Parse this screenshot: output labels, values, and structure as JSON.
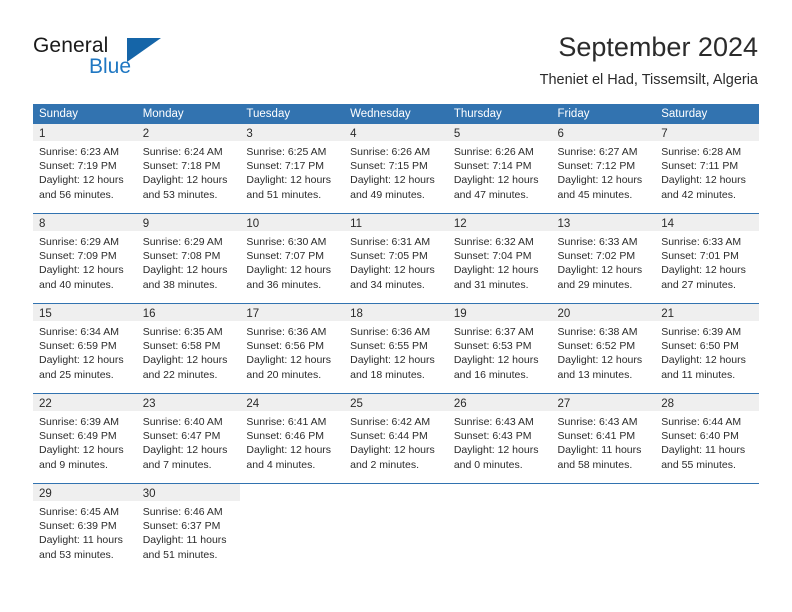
{
  "brand": {
    "name_top": "General",
    "name_bottom": "Blue",
    "accent_color": "#1f77c2",
    "triangle_color": "#1565a8"
  },
  "header": {
    "title": "September 2024",
    "subtitle": "Theniet el Had, Tissemsilt, Algeria"
  },
  "theme": {
    "header_blue": "#3273b0",
    "daynum_band": "#efefef",
    "text": "#2b2b2b"
  },
  "weekday_headers": [
    "Sunday",
    "Monday",
    "Tuesday",
    "Wednesday",
    "Thursday",
    "Friday",
    "Saturday"
  ],
  "weeks": [
    [
      {
        "day": "1",
        "sunrise": "Sunrise: 6:23 AM",
        "sunset": "Sunset: 7:19 PM",
        "daylight_1": "Daylight: 12 hours",
        "daylight_2": "and 56 minutes."
      },
      {
        "day": "2",
        "sunrise": "Sunrise: 6:24 AM",
        "sunset": "Sunset: 7:18 PM",
        "daylight_1": "Daylight: 12 hours",
        "daylight_2": "and 53 minutes."
      },
      {
        "day": "3",
        "sunrise": "Sunrise: 6:25 AM",
        "sunset": "Sunset: 7:17 PM",
        "daylight_1": "Daylight: 12 hours",
        "daylight_2": "and 51 minutes."
      },
      {
        "day": "4",
        "sunrise": "Sunrise: 6:26 AM",
        "sunset": "Sunset: 7:15 PM",
        "daylight_1": "Daylight: 12 hours",
        "daylight_2": "and 49 minutes."
      },
      {
        "day": "5",
        "sunrise": "Sunrise: 6:26 AM",
        "sunset": "Sunset: 7:14 PM",
        "daylight_1": "Daylight: 12 hours",
        "daylight_2": "and 47 minutes."
      },
      {
        "day": "6",
        "sunrise": "Sunrise: 6:27 AM",
        "sunset": "Sunset: 7:12 PM",
        "daylight_1": "Daylight: 12 hours",
        "daylight_2": "and 45 minutes."
      },
      {
        "day": "7",
        "sunrise": "Sunrise: 6:28 AM",
        "sunset": "Sunset: 7:11 PM",
        "daylight_1": "Daylight: 12 hours",
        "daylight_2": "and 42 minutes."
      }
    ],
    [
      {
        "day": "8",
        "sunrise": "Sunrise: 6:29 AM",
        "sunset": "Sunset: 7:09 PM",
        "daylight_1": "Daylight: 12 hours",
        "daylight_2": "and 40 minutes."
      },
      {
        "day": "9",
        "sunrise": "Sunrise: 6:29 AM",
        "sunset": "Sunset: 7:08 PM",
        "daylight_1": "Daylight: 12 hours",
        "daylight_2": "and 38 minutes."
      },
      {
        "day": "10",
        "sunrise": "Sunrise: 6:30 AM",
        "sunset": "Sunset: 7:07 PM",
        "daylight_1": "Daylight: 12 hours",
        "daylight_2": "and 36 minutes."
      },
      {
        "day": "11",
        "sunrise": "Sunrise: 6:31 AM",
        "sunset": "Sunset: 7:05 PM",
        "daylight_1": "Daylight: 12 hours",
        "daylight_2": "and 34 minutes."
      },
      {
        "day": "12",
        "sunrise": "Sunrise: 6:32 AM",
        "sunset": "Sunset: 7:04 PM",
        "daylight_1": "Daylight: 12 hours",
        "daylight_2": "and 31 minutes."
      },
      {
        "day": "13",
        "sunrise": "Sunrise: 6:33 AM",
        "sunset": "Sunset: 7:02 PM",
        "daylight_1": "Daylight: 12 hours",
        "daylight_2": "and 29 minutes."
      },
      {
        "day": "14",
        "sunrise": "Sunrise: 6:33 AM",
        "sunset": "Sunset: 7:01 PM",
        "daylight_1": "Daylight: 12 hours",
        "daylight_2": "and 27 minutes."
      }
    ],
    [
      {
        "day": "15",
        "sunrise": "Sunrise: 6:34 AM",
        "sunset": "Sunset: 6:59 PM",
        "daylight_1": "Daylight: 12 hours",
        "daylight_2": "and 25 minutes."
      },
      {
        "day": "16",
        "sunrise": "Sunrise: 6:35 AM",
        "sunset": "Sunset: 6:58 PM",
        "daylight_1": "Daylight: 12 hours",
        "daylight_2": "and 22 minutes."
      },
      {
        "day": "17",
        "sunrise": "Sunrise: 6:36 AM",
        "sunset": "Sunset: 6:56 PM",
        "daylight_1": "Daylight: 12 hours",
        "daylight_2": "and 20 minutes."
      },
      {
        "day": "18",
        "sunrise": "Sunrise: 6:36 AM",
        "sunset": "Sunset: 6:55 PM",
        "daylight_1": "Daylight: 12 hours",
        "daylight_2": "and 18 minutes."
      },
      {
        "day": "19",
        "sunrise": "Sunrise: 6:37 AM",
        "sunset": "Sunset: 6:53 PM",
        "daylight_1": "Daylight: 12 hours",
        "daylight_2": "and 16 minutes."
      },
      {
        "day": "20",
        "sunrise": "Sunrise: 6:38 AM",
        "sunset": "Sunset: 6:52 PM",
        "daylight_1": "Daylight: 12 hours",
        "daylight_2": "and 13 minutes."
      },
      {
        "day": "21",
        "sunrise": "Sunrise: 6:39 AM",
        "sunset": "Sunset: 6:50 PM",
        "daylight_1": "Daylight: 12 hours",
        "daylight_2": "and 11 minutes."
      }
    ],
    [
      {
        "day": "22",
        "sunrise": "Sunrise: 6:39 AM",
        "sunset": "Sunset: 6:49 PM",
        "daylight_1": "Daylight: 12 hours",
        "daylight_2": "and 9 minutes."
      },
      {
        "day": "23",
        "sunrise": "Sunrise: 6:40 AM",
        "sunset": "Sunset: 6:47 PM",
        "daylight_1": "Daylight: 12 hours",
        "daylight_2": "and 7 minutes."
      },
      {
        "day": "24",
        "sunrise": "Sunrise: 6:41 AM",
        "sunset": "Sunset: 6:46 PM",
        "daylight_1": "Daylight: 12 hours",
        "daylight_2": "and 4 minutes."
      },
      {
        "day": "25",
        "sunrise": "Sunrise: 6:42 AM",
        "sunset": "Sunset: 6:44 PM",
        "daylight_1": "Daylight: 12 hours",
        "daylight_2": "and 2 minutes."
      },
      {
        "day": "26",
        "sunrise": "Sunrise: 6:43 AM",
        "sunset": "Sunset: 6:43 PM",
        "daylight_1": "Daylight: 12 hours",
        "daylight_2": "and 0 minutes."
      },
      {
        "day": "27",
        "sunrise": "Sunrise: 6:43 AM",
        "sunset": "Sunset: 6:41 PM",
        "daylight_1": "Daylight: 11 hours",
        "daylight_2": "and 58 minutes."
      },
      {
        "day": "28",
        "sunrise": "Sunrise: 6:44 AM",
        "sunset": "Sunset: 6:40 PM",
        "daylight_1": "Daylight: 11 hours",
        "daylight_2": "and 55 minutes."
      }
    ],
    [
      {
        "day": "29",
        "sunrise": "Sunrise: 6:45 AM",
        "sunset": "Sunset: 6:39 PM",
        "daylight_1": "Daylight: 11 hours",
        "daylight_2": "and 53 minutes."
      },
      {
        "day": "30",
        "sunrise": "Sunrise: 6:46 AM",
        "sunset": "Sunset: 6:37 PM",
        "daylight_1": "Daylight: 11 hours",
        "daylight_2": "and 51 minutes."
      },
      {
        "day": "",
        "sunrise": "",
        "sunset": "",
        "daylight_1": "",
        "daylight_2": ""
      },
      {
        "day": "",
        "sunrise": "",
        "sunset": "",
        "daylight_1": "",
        "daylight_2": ""
      },
      {
        "day": "",
        "sunrise": "",
        "sunset": "",
        "daylight_1": "",
        "daylight_2": ""
      },
      {
        "day": "",
        "sunrise": "",
        "sunset": "",
        "daylight_1": "",
        "daylight_2": ""
      },
      {
        "day": "",
        "sunrise": "",
        "sunset": "",
        "daylight_1": "",
        "daylight_2": ""
      }
    ]
  ]
}
